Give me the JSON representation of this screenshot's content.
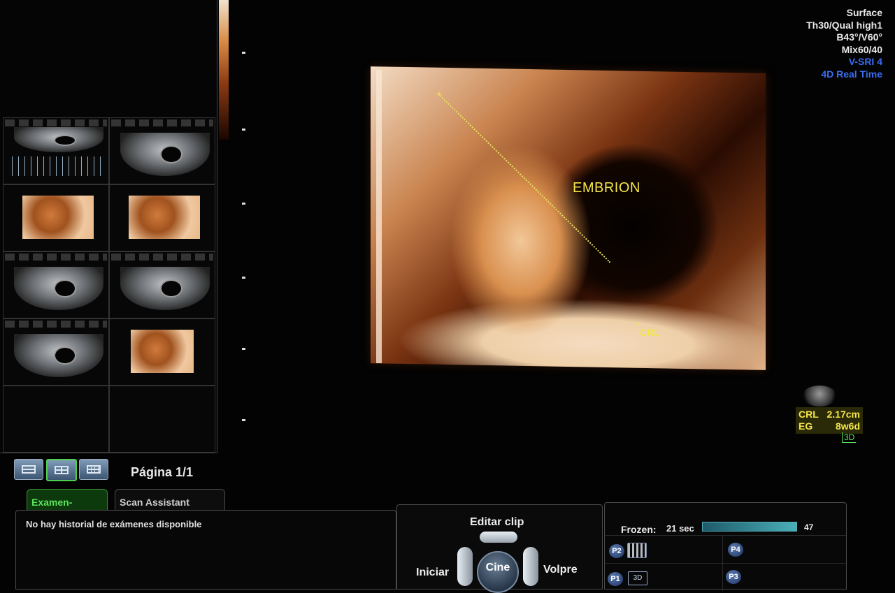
{
  "params": [
    "Surface",
    "Th30/Qual high1",
    "B43°/V60°",
    "Mix60/40",
    "V-SRI 4",
    "4D Real Time"
  ],
  "image": {
    "annotation": "EMBRION",
    "caliper_label": "CRL"
  },
  "measurement": {
    "rows": [
      {
        "label": "CRL",
        "value": "2.17cm"
      },
      {
        "label": "EG",
        "value": "8w6d"
      }
    ],
    "mode": "3D"
  },
  "layout_buttons": [
    "1x1",
    "2x2",
    "3x4"
  ],
  "active_layout": "2x2",
  "page_indicator": "Página 1/1",
  "tabs": {
    "history": "Examen-Histori",
    "scan_assistant": "Scan Assistant"
  },
  "history": {
    "message": "No hay historial de exámenes disponible"
  },
  "cine": {
    "edit_clip": "Editar clip",
    "start": "Iniciar",
    "knob": "Cine",
    "back": "Volpre"
  },
  "status": {
    "frozen_label": "Frozen:",
    "frozen_time": "21 sec",
    "frozen_progress": 0.97,
    "frozen_count": "47",
    "presets": [
      "P2",
      "P4",
      "P1",
      "P3"
    ],
    "p1_icon_text": "3D"
  },
  "colors": {
    "accent_yellow": "#f4e64a",
    "active_green": "#5ce35c",
    "param_blue": "#3a6df0"
  }
}
